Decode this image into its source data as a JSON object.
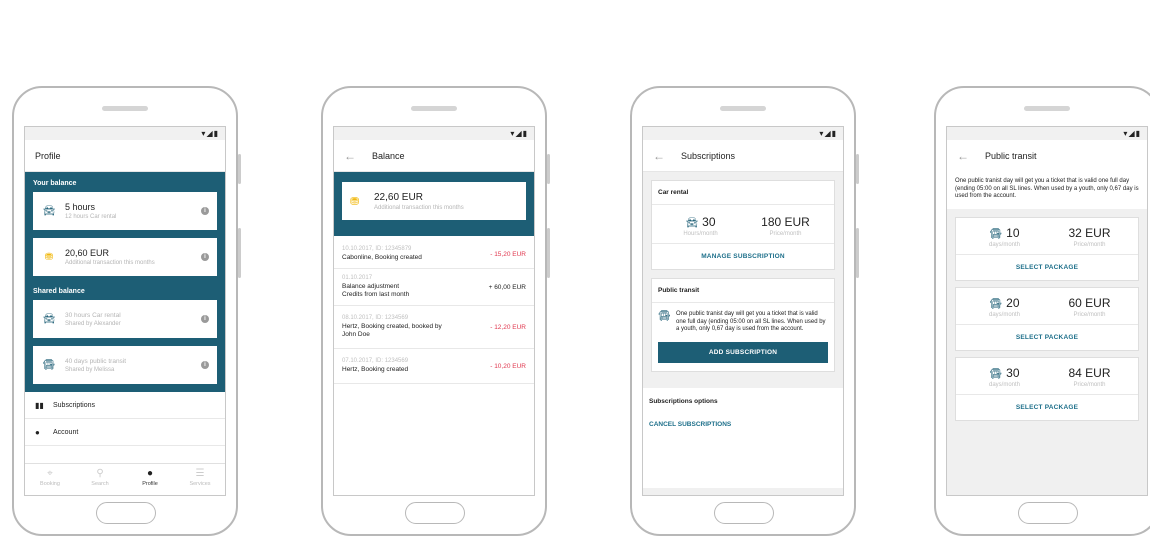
{
  "status_icons": "▾◢▮",
  "screen1": {
    "title": "Profile",
    "your_balance_label": "Your balance",
    "your_balance_items": [
      {
        "icon": "car-icon",
        "primary": "5 hours",
        "secondary": "12 hours Car rental"
      },
      {
        "icon": "coins-icon",
        "primary": "20,60 EUR",
        "secondary": "Additional transaction this months"
      }
    ],
    "shared_balance_label": "Shared balance",
    "shared_balance_items": [
      {
        "icon": "car-icon",
        "primary": "30 hours Car rental",
        "secondary": "Shared by Alexander"
      },
      {
        "icon": "bus-icon",
        "primary": "40 days public transit",
        "secondary": "Shared by Melissa"
      }
    ],
    "menu": [
      {
        "icon": "ticket-icon",
        "label": "Subscriptions"
      },
      {
        "icon": "person-icon",
        "label": "Account"
      }
    ],
    "nav": [
      {
        "icon": "pin-icon",
        "label": "Booking",
        "active": false
      },
      {
        "icon": "search-icon",
        "label": "Search",
        "active": false
      },
      {
        "icon": "profile-icon",
        "label": "Profile",
        "active": true
      },
      {
        "icon": "menu-icon",
        "label": "Services",
        "active": false
      }
    ]
  },
  "screen2": {
    "title": "Balance",
    "balance_amount": "22,60 EUR",
    "balance_note": "Additional transaction this months",
    "transactions": [
      {
        "date": "10.10.2017, ID: 12345879",
        "desc": "Cabonline, Booking created",
        "desc2": "",
        "amount": "- 15,20 EUR",
        "negative": true
      },
      {
        "date": "01.10.2017",
        "desc": "Balance adjustment",
        "desc2": "Credits from last month",
        "amount": "+ 60,00 EUR",
        "negative": false
      },
      {
        "date": "08.10.2017, ID: 1234569",
        "desc": "Hertz, Booking created, booked by",
        "desc2": "John Doe",
        "amount": "- 12,20 EUR",
        "negative": true
      },
      {
        "date": "07.10.2017, ID: 1234569",
        "desc": "Hertz, Booking created",
        "desc2": "",
        "amount": "- 10,20 EUR",
        "negative": true
      }
    ]
  },
  "screen3": {
    "title": "Subscriptions",
    "car_rental_header": "Car rental",
    "car_stat_value": "30",
    "car_stat_unit": "Hours/month",
    "car_price_value": "180 EUR",
    "car_price_unit": "Price/month",
    "manage_label": "MANAGE SUBSCRIPTION",
    "public_transit_header": "Public transit",
    "public_transit_desc": "One public tranist day will get you a ticket that is valid one full day (ending 05:00 on all SL lines. When used by a youth, only 0,67 day is used from the account.",
    "add_label": "ADD SUBSCRIPTION",
    "options_header": "Subscriptions options",
    "cancel_label": "CANCEL SUBSCRIPTIONS"
  },
  "screen4": {
    "title": "Public transit",
    "intro": "One public tranist day will get you a ticket that is valid one full day (ending 05:00 on all SL lines. When used by a youth, only 0,67 day is used from the account.",
    "packages": [
      {
        "days": "10",
        "days_unit": "days/month",
        "price": "32 EUR",
        "price_unit": "Price/month",
        "action": "SELECT PACKAGE"
      },
      {
        "days": "20",
        "days_unit": "days/month",
        "price": "60 EUR",
        "price_unit": "Price/month",
        "action": "SELECT PACKAGE"
      },
      {
        "days": "30",
        "days_unit": "days/month",
        "price": "84 EUR",
        "price_unit": "Price/month",
        "action": "SELECT PACKAGE"
      }
    ]
  }
}
